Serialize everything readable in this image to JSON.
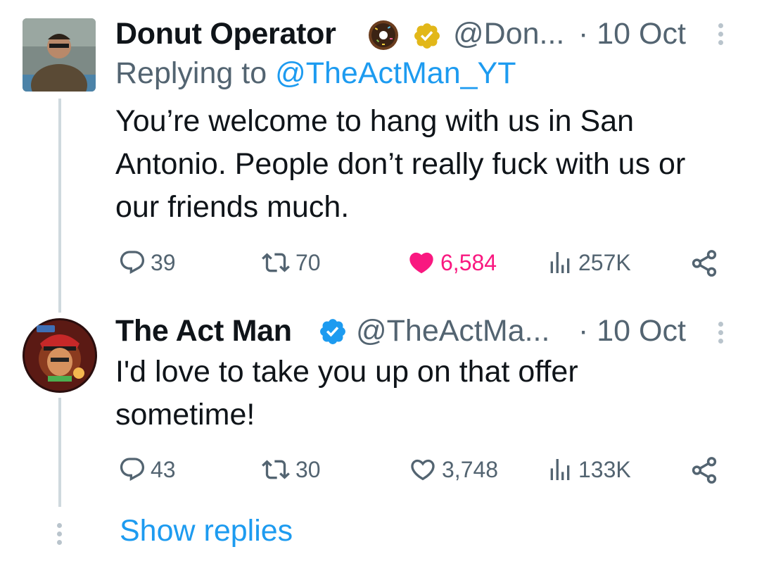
{
  "tweets": [
    {
      "name": "Donut Operator",
      "name_emoji": "🍩",
      "handle": "@Don...",
      "time": "· 10 Oct",
      "replying_to_prefix": "Replying to",
      "replying_to_handle": "@TheActMan_YT",
      "text": "You’re welcome to hang with us in San Antonio. People don’t really fuck with us or our friends much.",
      "stats": {
        "replies": "39",
        "retweets": "70",
        "likes": "6,584",
        "views": "257K"
      },
      "liked": true,
      "badge_color": "#e2b719"
    },
    {
      "name": "The Act Man",
      "handle": "@TheActMa...",
      "time": "· 10 Oct",
      "text": "I'd love to take you up on that offer sometime!",
      "stats": {
        "replies": "43",
        "retweets": "30",
        "likes": "3,748",
        "views": "133K"
      },
      "liked": false,
      "badge_color": "#1d9bf0"
    }
  ],
  "show_replies": "Show replies",
  "colors": {
    "accent": "#1d9bf0",
    "like": "#f91880",
    "secondary_text": "#536471"
  }
}
